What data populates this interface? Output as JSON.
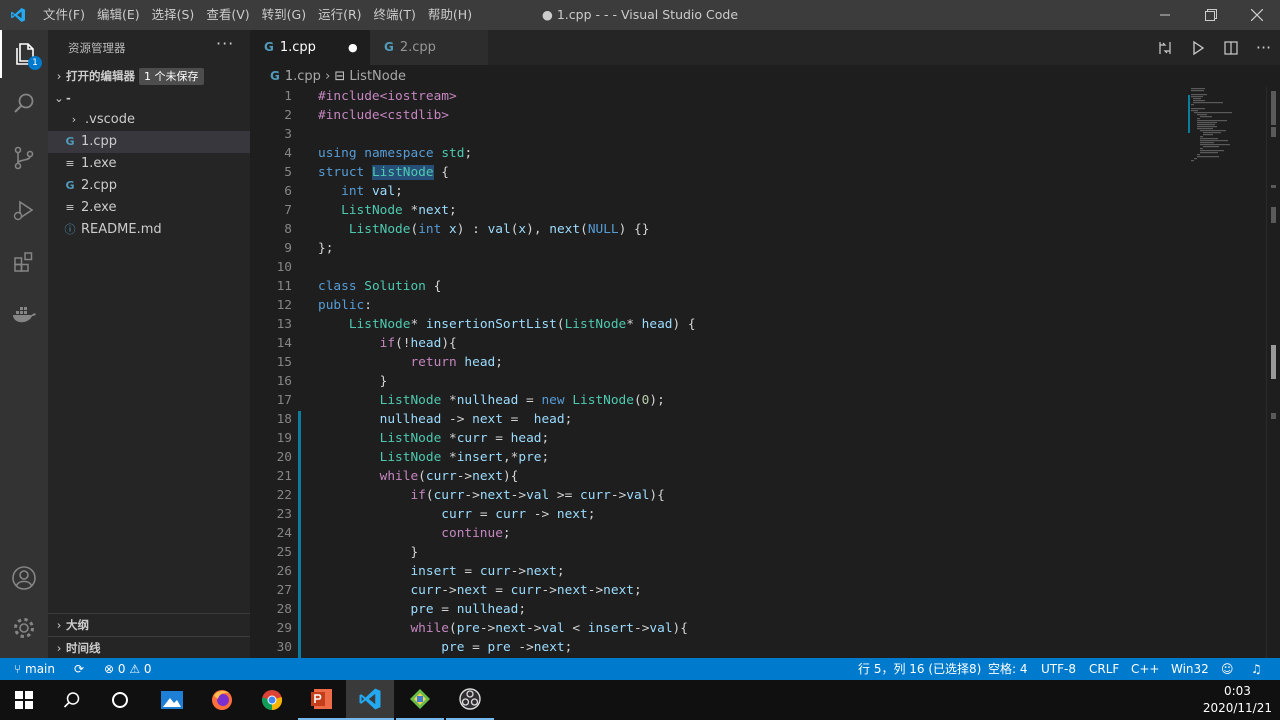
{
  "titlebar": {
    "menu": [
      "文件(F)",
      "编辑(E)",
      "选择(S)",
      "查看(V)",
      "转到(G)",
      "运行(R)",
      "终端(T)",
      "帮助(H)"
    ],
    "title": "● 1.cpp - - - Visual Studio Code"
  },
  "activity": {
    "explorer_badge": "1"
  },
  "sidebar": {
    "title": "资源管理器",
    "open_editors": "打开的编辑器",
    "unsaved_badge": "1 个未保存",
    "folder": "-",
    "files": [
      {
        "name": ".vscode",
        "icon": "folder"
      },
      {
        "name": "1.cpp",
        "icon": "c++"
      },
      {
        "name": "1.exe",
        "icon": "file"
      },
      {
        "name": "2.cpp",
        "icon": "c++"
      },
      {
        "name": "2.exe",
        "icon": "file"
      },
      {
        "name": "README.md",
        "icon": "info"
      }
    ],
    "outline": "大纲",
    "timeline": "时间线"
  },
  "tabs": [
    {
      "label": "1.cpp",
      "dirty": true
    },
    {
      "label": "2.cpp",
      "dirty": false
    }
  ],
  "breadcrumb": {
    "file": "1.cpp",
    "symbol": "ListNode"
  },
  "code": {
    "line_numbers": [
      "1",
      "2",
      "3",
      "4",
      "5",
      "6",
      "7",
      "8",
      "9",
      "10",
      "11",
      "12",
      "13",
      "14",
      "15",
      "16",
      "17",
      "18",
      "19",
      "20",
      "21",
      "22",
      "23",
      "24",
      "25",
      "26",
      "27",
      "28",
      "29",
      "30"
    ],
    "lines": [
      "#include<iostream>",
      "#include<cstdlib>",
      "",
      "using namespace std;",
      "struct ListNode {",
      "   int val;",
      "   ListNode *next;",
      "    ListNode(int x) : val(x), next(NULL) {}",
      "};",
      "",
      "class Solution {",
      "public:",
      "    ListNode* insertionSortList(ListNode* head) {",
      "        if(!head){",
      "            return head;",
      "        }",
      "        ListNode *nullhead = new ListNode(0);",
      "        nullhead -> next =  head;",
      "        ListNode *curr = head;",
      "        ListNode *insert,*pre;",
      "        while(curr->next){",
      "            if(curr->next->val >= curr->val){",
      "                curr = curr -> next;",
      "                continue;",
      "            }",
      "            insert = curr->next;",
      "            curr->next = curr->next->next;",
      "            pre = nullhead;",
      "            while(pre->next->val < insert->val){",
      "                pre = pre ->next;"
    ]
  },
  "status": {
    "branch": "main",
    "errors": "0",
    "warnings": "0",
    "position": "行 5，列 16 (已选择8)",
    "spaces": "空格: 4",
    "encoding": "UTF-8",
    "eol": "CRLF",
    "language": "C++",
    "platform": "Win32"
  },
  "taskbar": {
    "time": "0:03",
    "date": "2020/11/21"
  }
}
